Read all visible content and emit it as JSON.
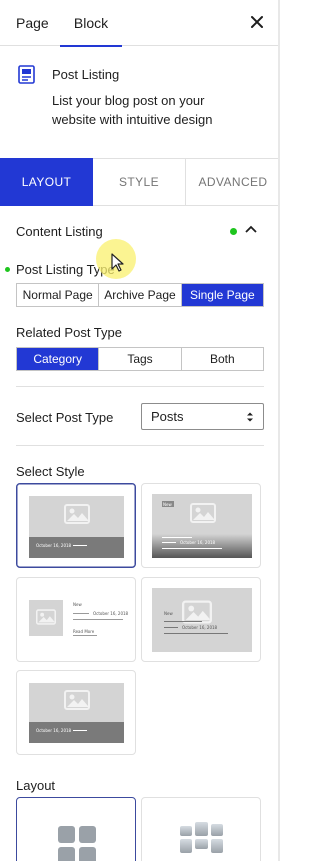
{
  "top_tabs": {
    "page": "Page",
    "block": "Block"
  },
  "block_info": {
    "title": "Post Listing",
    "description": "List your blog post on your website with intuitive design"
  },
  "panel_tabs": [
    {
      "label": "LAYOUT",
      "active": true
    },
    {
      "label": "STYLE",
      "active": false
    },
    {
      "label": "ADVANCED",
      "active": false
    }
  ],
  "content_listing": {
    "title": "Content Listing",
    "post_listing_type": {
      "label": "Post Listing Type",
      "options": [
        "Normal Page",
        "Archive Page",
        "Single Page"
      ],
      "selected": "Single Page"
    },
    "related_post_type": {
      "label": "Related Post Type",
      "options": [
        "Category",
        "Tags",
        "Both"
      ],
      "selected": "Category"
    },
    "select_post_type": {
      "label": "Select Post Type",
      "value": "Posts"
    },
    "select_style": {
      "label": "Select Style",
      "cards": [
        {
          "name": "style-1",
          "date": "October 16, 2018",
          "selected": true
        },
        {
          "name": "style-2",
          "badge": "New",
          "date": "October 16, 2018",
          "selected": false
        },
        {
          "name": "style-3",
          "badge": "New",
          "date": "October 16, 2018",
          "read_more": "Read More",
          "selected": false
        },
        {
          "name": "style-4",
          "badge": "New",
          "date": "October 16, 2018",
          "selected": false
        },
        {
          "name": "style-5",
          "date": "October 16, 2018",
          "selected": false
        }
      ]
    },
    "layout": {
      "label": "Layout"
    }
  },
  "colors": {
    "accent": "#2238d4",
    "status_dot": "#1ec51e",
    "highlight": "#faf06e"
  }
}
